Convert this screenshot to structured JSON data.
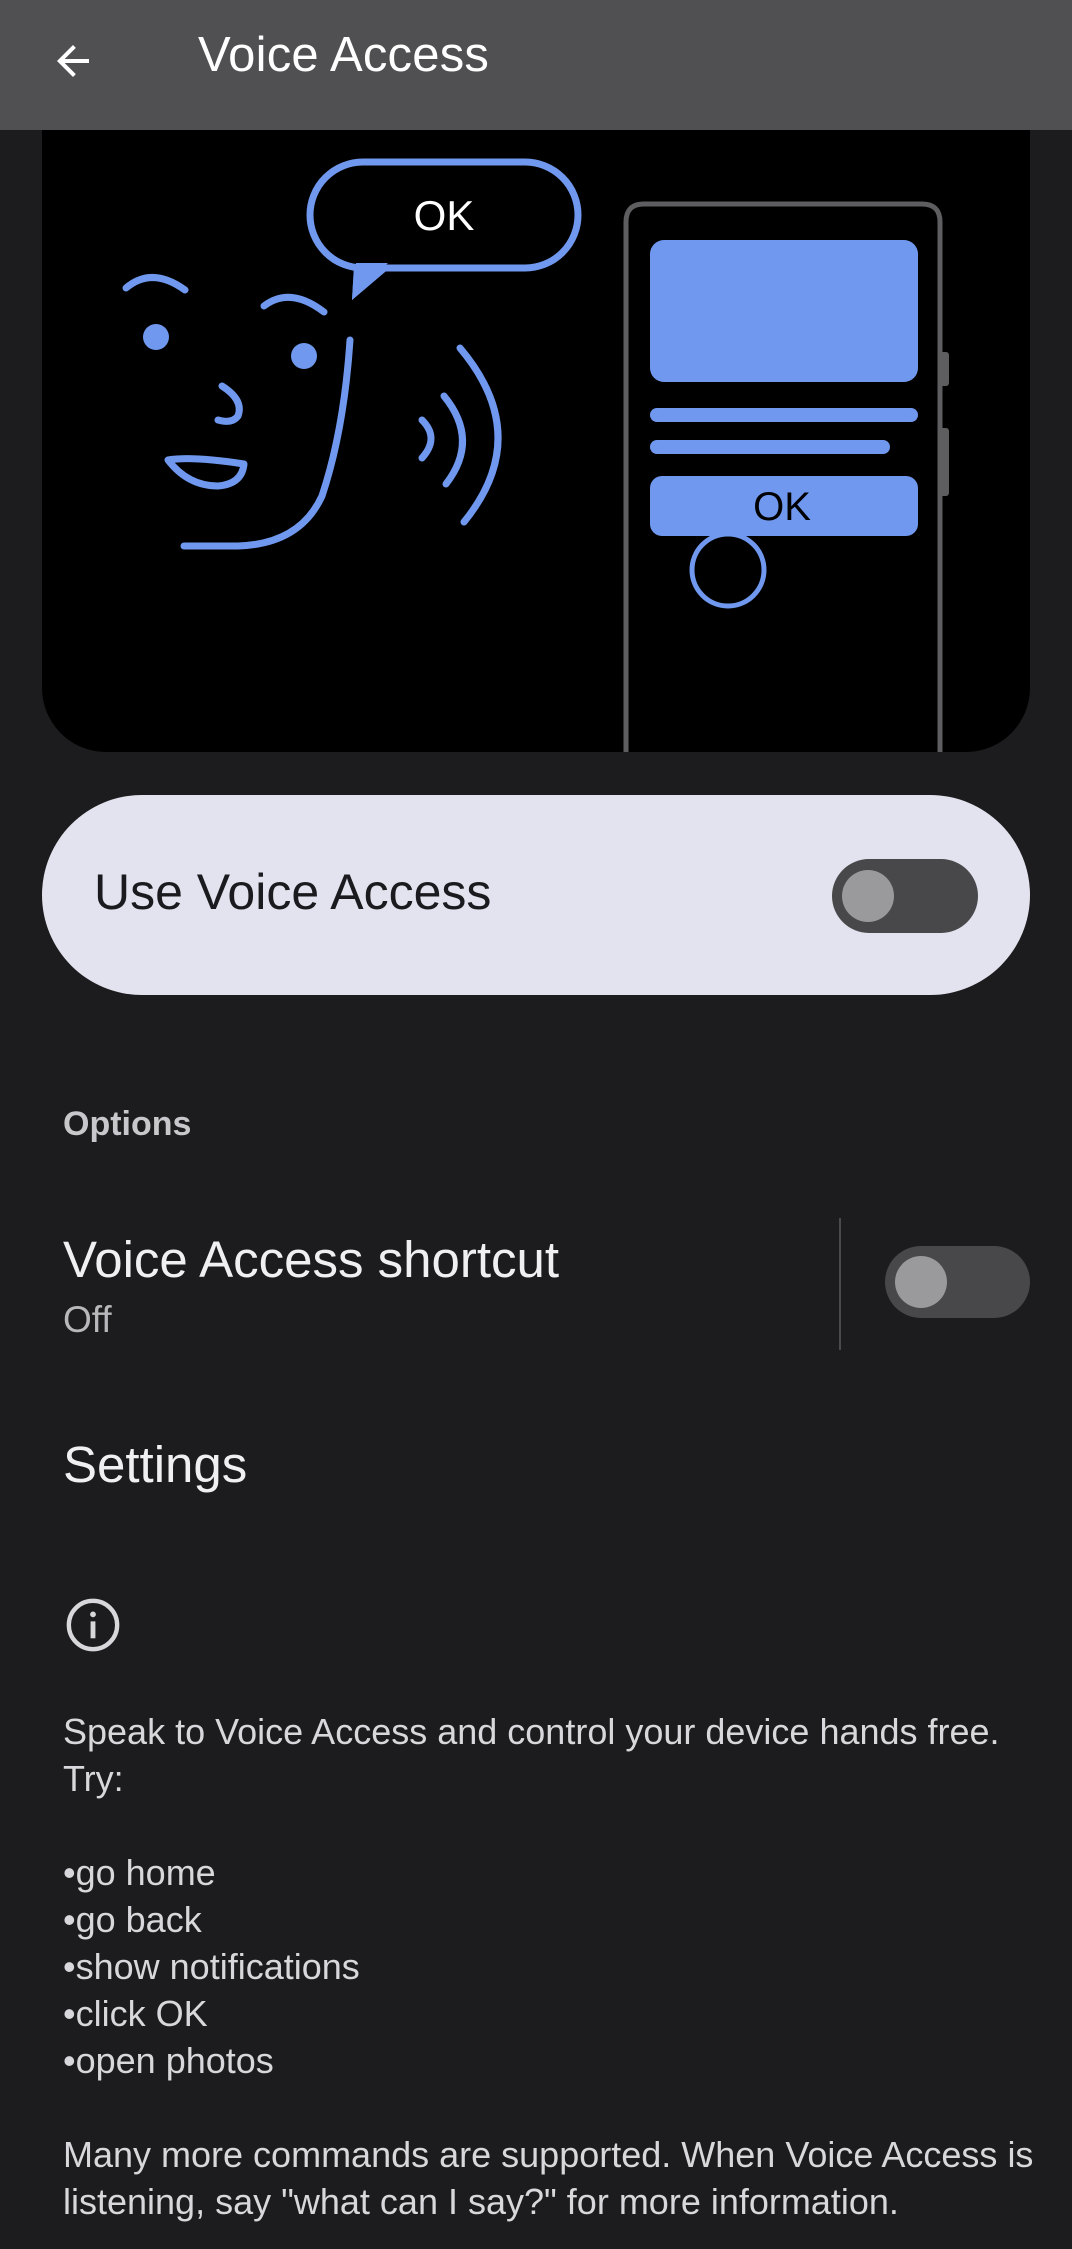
{
  "appbar": {
    "title": "Voice Access",
    "back_icon": "arrow-left-icon"
  },
  "illustration": {
    "speech_bubble_text": "OK",
    "phone_button_text": "OK",
    "accent_color": "#6f98ee"
  },
  "main_toggle": {
    "label": "Use Voice Access",
    "checked": false
  },
  "options": {
    "header": "Options",
    "shortcut": {
      "title": "Voice Access shortcut",
      "status": "Off",
      "checked": false
    },
    "settings_label": "Settings"
  },
  "about": {
    "icon": "info-icon",
    "intro": "Speak to Voice Access and control your device hands free. Try:",
    "examples": [
      "go home",
      "go back",
      "show notifications",
      "click OK",
      "open photos"
    ],
    "footer": "Many more commands are supported. When Voice Access is listening, say \"what can I say?\" for more information."
  },
  "colors": {
    "appbar_bg": "#505052",
    "page_bg": "#1c1c1e",
    "card_bg": "#e3e3ef"
  }
}
